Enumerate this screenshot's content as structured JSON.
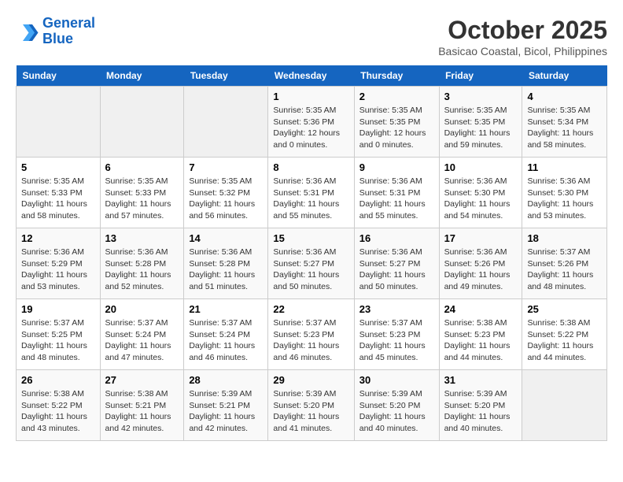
{
  "header": {
    "logo_line1": "General",
    "logo_line2": "Blue",
    "month": "October 2025",
    "location": "Basicao Coastal, Bicol, Philippines"
  },
  "days_of_week": [
    "Sunday",
    "Monday",
    "Tuesday",
    "Wednesday",
    "Thursday",
    "Friday",
    "Saturday"
  ],
  "weeks": [
    [
      {
        "day": "",
        "info": ""
      },
      {
        "day": "",
        "info": ""
      },
      {
        "day": "",
        "info": ""
      },
      {
        "day": "1",
        "info": "Sunrise: 5:35 AM\nSunset: 5:36 PM\nDaylight: 12 hours\nand 0 minutes."
      },
      {
        "day": "2",
        "info": "Sunrise: 5:35 AM\nSunset: 5:35 PM\nDaylight: 12 hours\nand 0 minutes."
      },
      {
        "day": "3",
        "info": "Sunrise: 5:35 AM\nSunset: 5:35 PM\nDaylight: 11 hours\nand 59 minutes."
      },
      {
        "day": "4",
        "info": "Sunrise: 5:35 AM\nSunset: 5:34 PM\nDaylight: 11 hours\nand 58 minutes."
      }
    ],
    [
      {
        "day": "5",
        "info": "Sunrise: 5:35 AM\nSunset: 5:33 PM\nDaylight: 11 hours\nand 58 minutes."
      },
      {
        "day": "6",
        "info": "Sunrise: 5:35 AM\nSunset: 5:33 PM\nDaylight: 11 hours\nand 57 minutes."
      },
      {
        "day": "7",
        "info": "Sunrise: 5:35 AM\nSunset: 5:32 PM\nDaylight: 11 hours\nand 56 minutes."
      },
      {
        "day": "8",
        "info": "Sunrise: 5:36 AM\nSunset: 5:31 PM\nDaylight: 11 hours\nand 55 minutes."
      },
      {
        "day": "9",
        "info": "Sunrise: 5:36 AM\nSunset: 5:31 PM\nDaylight: 11 hours\nand 55 minutes."
      },
      {
        "day": "10",
        "info": "Sunrise: 5:36 AM\nSunset: 5:30 PM\nDaylight: 11 hours\nand 54 minutes."
      },
      {
        "day": "11",
        "info": "Sunrise: 5:36 AM\nSunset: 5:30 PM\nDaylight: 11 hours\nand 53 minutes."
      }
    ],
    [
      {
        "day": "12",
        "info": "Sunrise: 5:36 AM\nSunset: 5:29 PM\nDaylight: 11 hours\nand 53 minutes."
      },
      {
        "day": "13",
        "info": "Sunrise: 5:36 AM\nSunset: 5:28 PM\nDaylight: 11 hours\nand 52 minutes."
      },
      {
        "day": "14",
        "info": "Sunrise: 5:36 AM\nSunset: 5:28 PM\nDaylight: 11 hours\nand 51 minutes."
      },
      {
        "day": "15",
        "info": "Sunrise: 5:36 AM\nSunset: 5:27 PM\nDaylight: 11 hours\nand 50 minutes."
      },
      {
        "day": "16",
        "info": "Sunrise: 5:36 AM\nSunset: 5:27 PM\nDaylight: 11 hours\nand 50 minutes."
      },
      {
        "day": "17",
        "info": "Sunrise: 5:36 AM\nSunset: 5:26 PM\nDaylight: 11 hours\nand 49 minutes."
      },
      {
        "day": "18",
        "info": "Sunrise: 5:37 AM\nSunset: 5:26 PM\nDaylight: 11 hours\nand 48 minutes."
      }
    ],
    [
      {
        "day": "19",
        "info": "Sunrise: 5:37 AM\nSunset: 5:25 PM\nDaylight: 11 hours\nand 48 minutes."
      },
      {
        "day": "20",
        "info": "Sunrise: 5:37 AM\nSunset: 5:24 PM\nDaylight: 11 hours\nand 47 minutes."
      },
      {
        "day": "21",
        "info": "Sunrise: 5:37 AM\nSunset: 5:24 PM\nDaylight: 11 hours\nand 46 minutes."
      },
      {
        "day": "22",
        "info": "Sunrise: 5:37 AM\nSunset: 5:23 PM\nDaylight: 11 hours\nand 46 minutes."
      },
      {
        "day": "23",
        "info": "Sunrise: 5:37 AM\nSunset: 5:23 PM\nDaylight: 11 hours\nand 45 minutes."
      },
      {
        "day": "24",
        "info": "Sunrise: 5:38 AM\nSunset: 5:23 PM\nDaylight: 11 hours\nand 44 minutes."
      },
      {
        "day": "25",
        "info": "Sunrise: 5:38 AM\nSunset: 5:22 PM\nDaylight: 11 hours\nand 44 minutes."
      }
    ],
    [
      {
        "day": "26",
        "info": "Sunrise: 5:38 AM\nSunset: 5:22 PM\nDaylight: 11 hours\nand 43 minutes."
      },
      {
        "day": "27",
        "info": "Sunrise: 5:38 AM\nSunset: 5:21 PM\nDaylight: 11 hours\nand 42 minutes."
      },
      {
        "day": "28",
        "info": "Sunrise: 5:39 AM\nSunset: 5:21 PM\nDaylight: 11 hours\nand 42 minutes."
      },
      {
        "day": "29",
        "info": "Sunrise: 5:39 AM\nSunset: 5:20 PM\nDaylight: 11 hours\nand 41 minutes."
      },
      {
        "day": "30",
        "info": "Sunrise: 5:39 AM\nSunset: 5:20 PM\nDaylight: 11 hours\nand 40 minutes."
      },
      {
        "day": "31",
        "info": "Sunrise: 5:39 AM\nSunset: 5:20 PM\nDaylight: 11 hours\nand 40 minutes."
      },
      {
        "day": "",
        "info": ""
      }
    ]
  ]
}
